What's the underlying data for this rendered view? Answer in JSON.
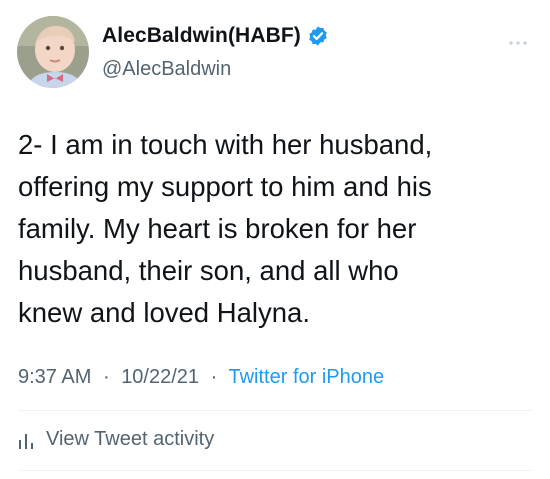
{
  "author": {
    "display_name": "AlecBaldwin(HABF)",
    "handle": "@AlecBaldwin"
  },
  "icons": {
    "avatar": "baby-profile-photo",
    "verified": "verified-badge-icon",
    "more": "more-options-icon",
    "activity": "bar-chart-icon"
  },
  "tweet": {
    "lines": [
      "2- I am in touch with her husband,",
      "offering my support to him and his",
      "family. My heart is broken for her",
      "husband, their son, and all who",
      "knew and loved Halyna."
    ]
  },
  "meta": {
    "time": "9:37 AM",
    "separator": "·",
    "date": "10/22/21",
    "source": "Twitter for iPhone"
  },
  "activity": {
    "label": "View Tweet activity"
  },
  "colors": {
    "verified": "#1d9bf0",
    "link": "#1d9bf0",
    "secondary_text": "#536471"
  }
}
